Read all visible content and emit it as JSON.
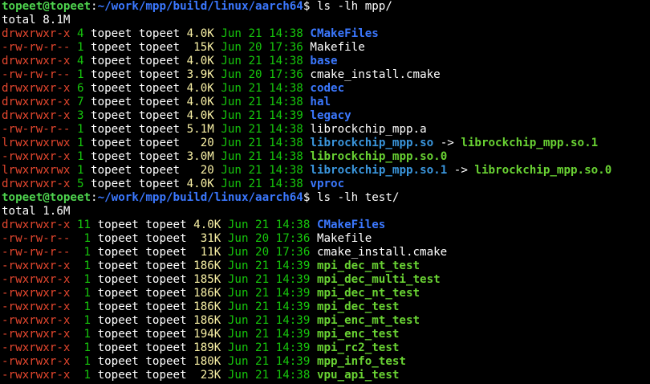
{
  "prompt1": {
    "userhost": "topeet@topeet",
    "colon": ":",
    "path": "~/work/mpp/build/linux/aarch64",
    "symbol": "$",
    "command": " ls -lh mpp/"
  },
  "total1": "total 8.1M",
  "listing1": [
    {
      "perm": "drwxrwxr-x",
      "links": " 4",
      "owner": " topeet topeet ",
      "size": "4.0K",
      "date": " Jun 21 14:38 ",
      "name": "CMakeFiles",
      "type": "dir"
    },
    {
      "perm": "-rw-rw-r--",
      "links": " 1",
      "owner": " topeet topeet ",
      "size": " 15K",
      "date": " Jun 20 17:36 ",
      "name": "Makefile",
      "type": "file"
    },
    {
      "perm": "drwxrwxr-x",
      "links": " 4",
      "owner": " topeet topeet ",
      "size": "4.0K",
      "date": " Jun 21 14:38 ",
      "name": "base",
      "type": "dir"
    },
    {
      "perm": "-rw-rw-r--",
      "links": " 1",
      "owner": " topeet topeet ",
      "size": "3.9K",
      "date": " Jun 20 17:36 ",
      "name": "cmake_install.cmake",
      "type": "file"
    },
    {
      "perm": "drwxrwxr-x",
      "links": " 6",
      "owner": " topeet topeet ",
      "size": "4.0K",
      "date": " Jun 21 14:38 ",
      "name": "codec",
      "type": "dir"
    },
    {
      "perm": "drwxrwxr-x",
      "links": " 7",
      "owner": " topeet topeet ",
      "size": "4.0K",
      "date": " Jun 21 14:38 ",
      "name": "hal",
      "type": "dir"
    },
    {
      "perm": "drwxrwxr-x",
      "links": " 3",
      "owner": " topeet topeet ",
      "size": "4.0K",
      "date": " Jun 21 14:39 ",
      "name": "legacy",
      "type": "dir"
    },
    {
      "perm": "-rw-rw-r--",
      "links": " 1",
      "owner": " topeet topeet ",
      "size": "5.1M",
      "date": " Jun 21 14:38 ",
      "name": "librockchip_mpp.a",
      "type": "file"
    },
    {
      "perm": "lrwxrwxrwx",
      "links": " 1",
      "owner": " topeet topeet ",
      "size": "  20",
      "date": " Jun 21 14:38 ",
      "name": "librockchip_mpp.so",
      "type": "link",
      "arrow": " -> ",
      "target": "librockchip_mpp.so.1"
    },
    {
      "perm": "-rwxrwxr-x",
      "links": " 1",
      "owner": " topeet topeet ",
      "size": "3.0M",
      "date": " Jun 21 14:38 ",
      "name": "librockchip_mpp.so.0",
      "type": "exec"
    },
    {
      "perm": "lrwxrwxrwx",
      "links": " 1",
      "owner": " topeet topeet ",
      "size": "  20",
      "date": " Jun 21 14:38 ",
      "name": "librockchip_mpp.so.1",
      "type": "link",
      "arrow": " -> ",
      "target": "librockchip_mpp.so.0"
    },
    {
      "perm": "drwxrwxr-x",
      "links": " 5",
      "owner": " topeet topeet ",
      "size": "4.0K",
      "date": " Jun 21 14:38 ",
      "name": "vproc",
      "type": "dir"
    }
  ],
  "prompt2": {
    "userhost": "topeet@topeet",
    "colon": ":",
    "path": "~/work/mpp/build/linux/aarch64",
    "symbol": "$",
    "command": " ls -lh test/"
  },
  "total2": "total 1.6M",
  "listing2": [
    {
      "perm": "drwxrwxr-x",
      "links": " 11",
      "owner": " topeet topeet ",
      "size": "4.0K",
      "date": " Jun 21 14:38 ",
      "name": "CMakeFiles",
      "type": "dir"
    },
    {
      "perm": "-rw-rw-r--",
      "links": "  1",
      "owner": " topeet topeet ",
      "size": " 31K",
      "date": " Jun 20 17:36 ",
      "name": "Makefile",
      "type": "file"
    },
    {
      "perm": "-rw-rw-r--",
      "links": "  1",
      "owner": " topeet topeet ",
      "size": " 11K",
      "date": " Jun 20 17:36 ",
      "name": "cmake_install.cmake",
      "type": "file"
    },
    {
      "perm": "-rwxrwxr-x",
      "links": "  1",
      "owner": " topeet topeet ",
      "size": "186K",
      "date": " Jun 21 14:39 ",
      "name": "mpi_dec_mt_test",
      "type": "exec"
    },
    {
      "perm": "-rwxrwxr-x",
      "links": "  1",
      "owner": " topeet topeet ",
      "size": "185K",
      "date": " Jun 21 14:39 ",
      "name": "mpi_dec_multi_test",
      "type": "exec"
    },
    {
      "perm": "-rwxrwxr-x",
      "links": "  1",
      "owner": " topeet topeet ",
      "size": "186K",
      "date": " Jun 21 14:39 ",
      "name": "mpi_dec_nt_test",
      "type": "exec"
    },
    {
      "perm": "-rwxrwxr-x",
      "links": "  1",
      "owner": " topeet topeet ",
      "size": "186K",
      "date": " Jun 21 14:39 ",
      "name": "mpi_dec_test",
      "type": "exec"
    },
    {
      "perm": "-rwxrwxr-x",
      "links": "  1",
      "owner": " topeet topeet ",
      "size": "186K",
      "date": " Jun 21 14:39 ",
      "name": "mpi_enc_mt_test",
      "type": "exec"
    },
    {
      "perm": "-rwxrwxr-x",
      "links": "  1",
      "owner": " topeet topeet ",
      "size": "194K",
      "date": " Jun 21 14:39 ",
      "name": "mpi_enc_test",
      "type": "exec"
    },
    {
      "perm": "-rwxrwxr-x",
      "links": "  1",
      "owner": " topeet topeet ",
      "size": "189K",
      "date": " Jun 21 14:39 ",
      "name": "mpi_rc2_test",
      "type": "exec"
    },
    {
      "perm": "-rwxrwxr-x",
      "links": "  1",
      "owner": " topeet topeet ",
      "size": "180K",
      "date": " Jun 21 14:39 ",
      "name": "mpp_info_test",
      "type": "exec"
    },
    {
      "perm": "-rwxrwxr-x",
      "links": "  1",
      "owner": " topeet topeet ",
      "size": " 23K",
      "date": " Jun 21 14:38 ",
      "name": "vpu_api_test",
      "type": "exec"
    }
  ]
}
